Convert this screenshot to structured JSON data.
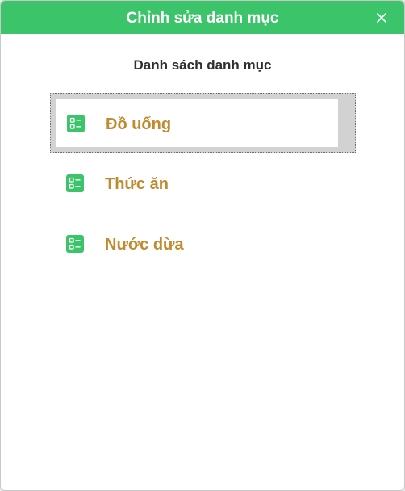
{
  "dialog": {
    "title": "Chỉnh sửa danh mục",
    "close_icon": "close-icon"
  },
  "heading": "Danh sách danh mục",
  "categories": [
    {
      "label": "Đồ uống",
      "icon": "list-icon",
      "selected": true
    },
    {
      "label": "Thức ăn",
      "icon": "list-icon",
      "selected": false
    },
    {
      "label": "Nước dừa",
      "icon": "list-icon",
      "selected": false
    }
  ],
  "colors": {
    "titlebar": "#3cc46a",
    "title_text": "#ffffff",
    "icon": "#3cc46a",
    "item_label": "#bf8b2e",
    "selected_bg": "#d2d2d2"
  }
}
